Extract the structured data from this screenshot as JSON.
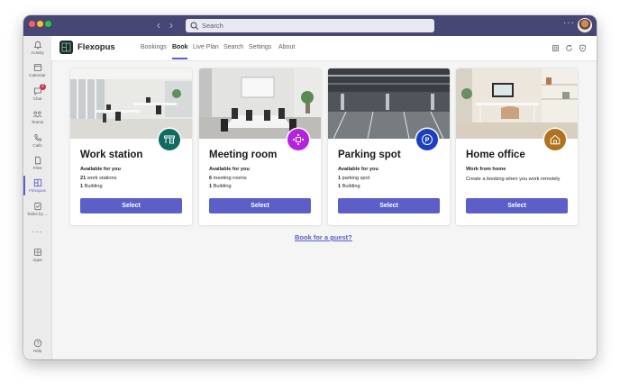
{
  "titlebar": {
    "search_placeholder": "Search",
    "back_icon": "chevron-left-icon",
    "forward_icon": "chevron-right-icon",
    "more_icon": "more-icon",
    "avatar_icon": "user-avatar"
  },
  "rail": {
    "items": [
      {
        "label": "Activity",
        "icon": "bell-icon"
      },
      {
        "label": "Calendar",
        "icon": "calendar-icon"
      },
      {
        "label": "Chat",
        "icon": "chat-icon",
        "badge": "2"
      },
      {
        "label": "Teams",
        "icon": "teams-icon"
      },
      {
        "label": "Calls",
        "icon": "phone-icon"
      },
      {
        "label": "Files",
        "icon": "file-icon"
      },
      {
        "label": "Flexopus",
        "icon": "flexopus-icon",
        "active": true
      },
      {
        "label": "Tasks by ...",
        "icon": "tasks-icon"
      },
      {
        "label": "Apps",
        "icon": "apps-icon"
      },
      {
        "label": "Help",
        "icon": "help-icon"
      }
    ]
  },
  "header": {
    "app_name": "Flexopus",
    "tabs": [
      {
        "label": "Bookings"
      },
      {
        "label": "Book",
        "active": true
      },
      {
        "label": "Live Plan"
      },
      {
        "label": "Search"
      },
      {
        "label": "Settings"
      },
      {
        "label": "About"
      }
    ],
    "icons": [
      "popout-icon",
      "refresh-icon",
      "shield-icon"
    ]
  },
  "cards": [
    {
      "title": "Work station",
      "subtitle": "Available for you",
      "line1_count": "21",
      "line1_text": " work stations",
      "line2_count": "1",
      "line2_text": " Building",
      "button": "Select",
      "badge_icon": "desk-icon",
      "badge_color": "#0f6b5f"
    },
    {
      "title": "Meeting room",
      "subtitle": "Available for you",
      "line1_count": "6",
      "line1_text": " meeting rooms",
      "line2_count": "1",
      "line2_text": " Building",
      "button": "Select",
      "badge_icon": "meeting-icon",
      "badge_color": "#b620e0"
    },
    {
      "title": "Parking spot",
      "subtitle": "Available for you",
      "line1_count": "1",
      "line1_text": " parking spot",
      "line2_count": "1",
      "line2_text": " Building",
      "button": "Select",
      "badge_icon": "parking-icon",
      "badge_color": "#1c3fbf"
    },
    {
      "title": "Home office",
      "subtitle": "Work from home",
      "description": "Create a booking when you work remotely",
      "button": "Select",
      "badge_icon": "home-icon",
      "badge_color": "#b0721d"
    }
  ],
  "guest_link": "Book for a guest?",
  "colors": {
    "titlebar": "#464775",
    "accent": "#5b5fc7",
    "background": "#f5f5f5"
  }
}
